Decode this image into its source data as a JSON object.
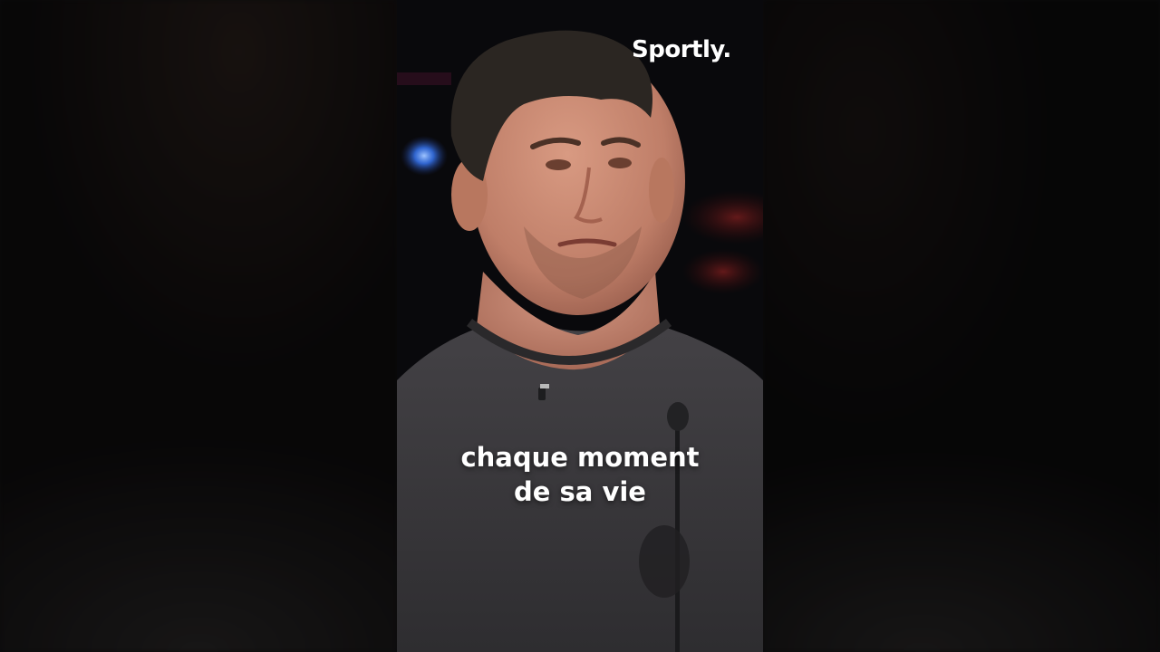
{
  "overlay": {
    "brand_label": "Sportly.",
    "caption": {
      "line1": "chaque moment",
      "line2": "de sa vie"
    }
  },
  "scene": {
    "subject": "man in dark grey t-shirt at judge desk",
    "background": "dark studio with blue and red stage lights",
    "colors": {
      "backdrop": "#09090c",
      "shirt": "#3a393b",
      "skin": "#c98c76",
      "hair": "#2b2622",
      "blue_light": "#3a7cff",
      "red_light": "#7a1a1a"
    }
  }
}
